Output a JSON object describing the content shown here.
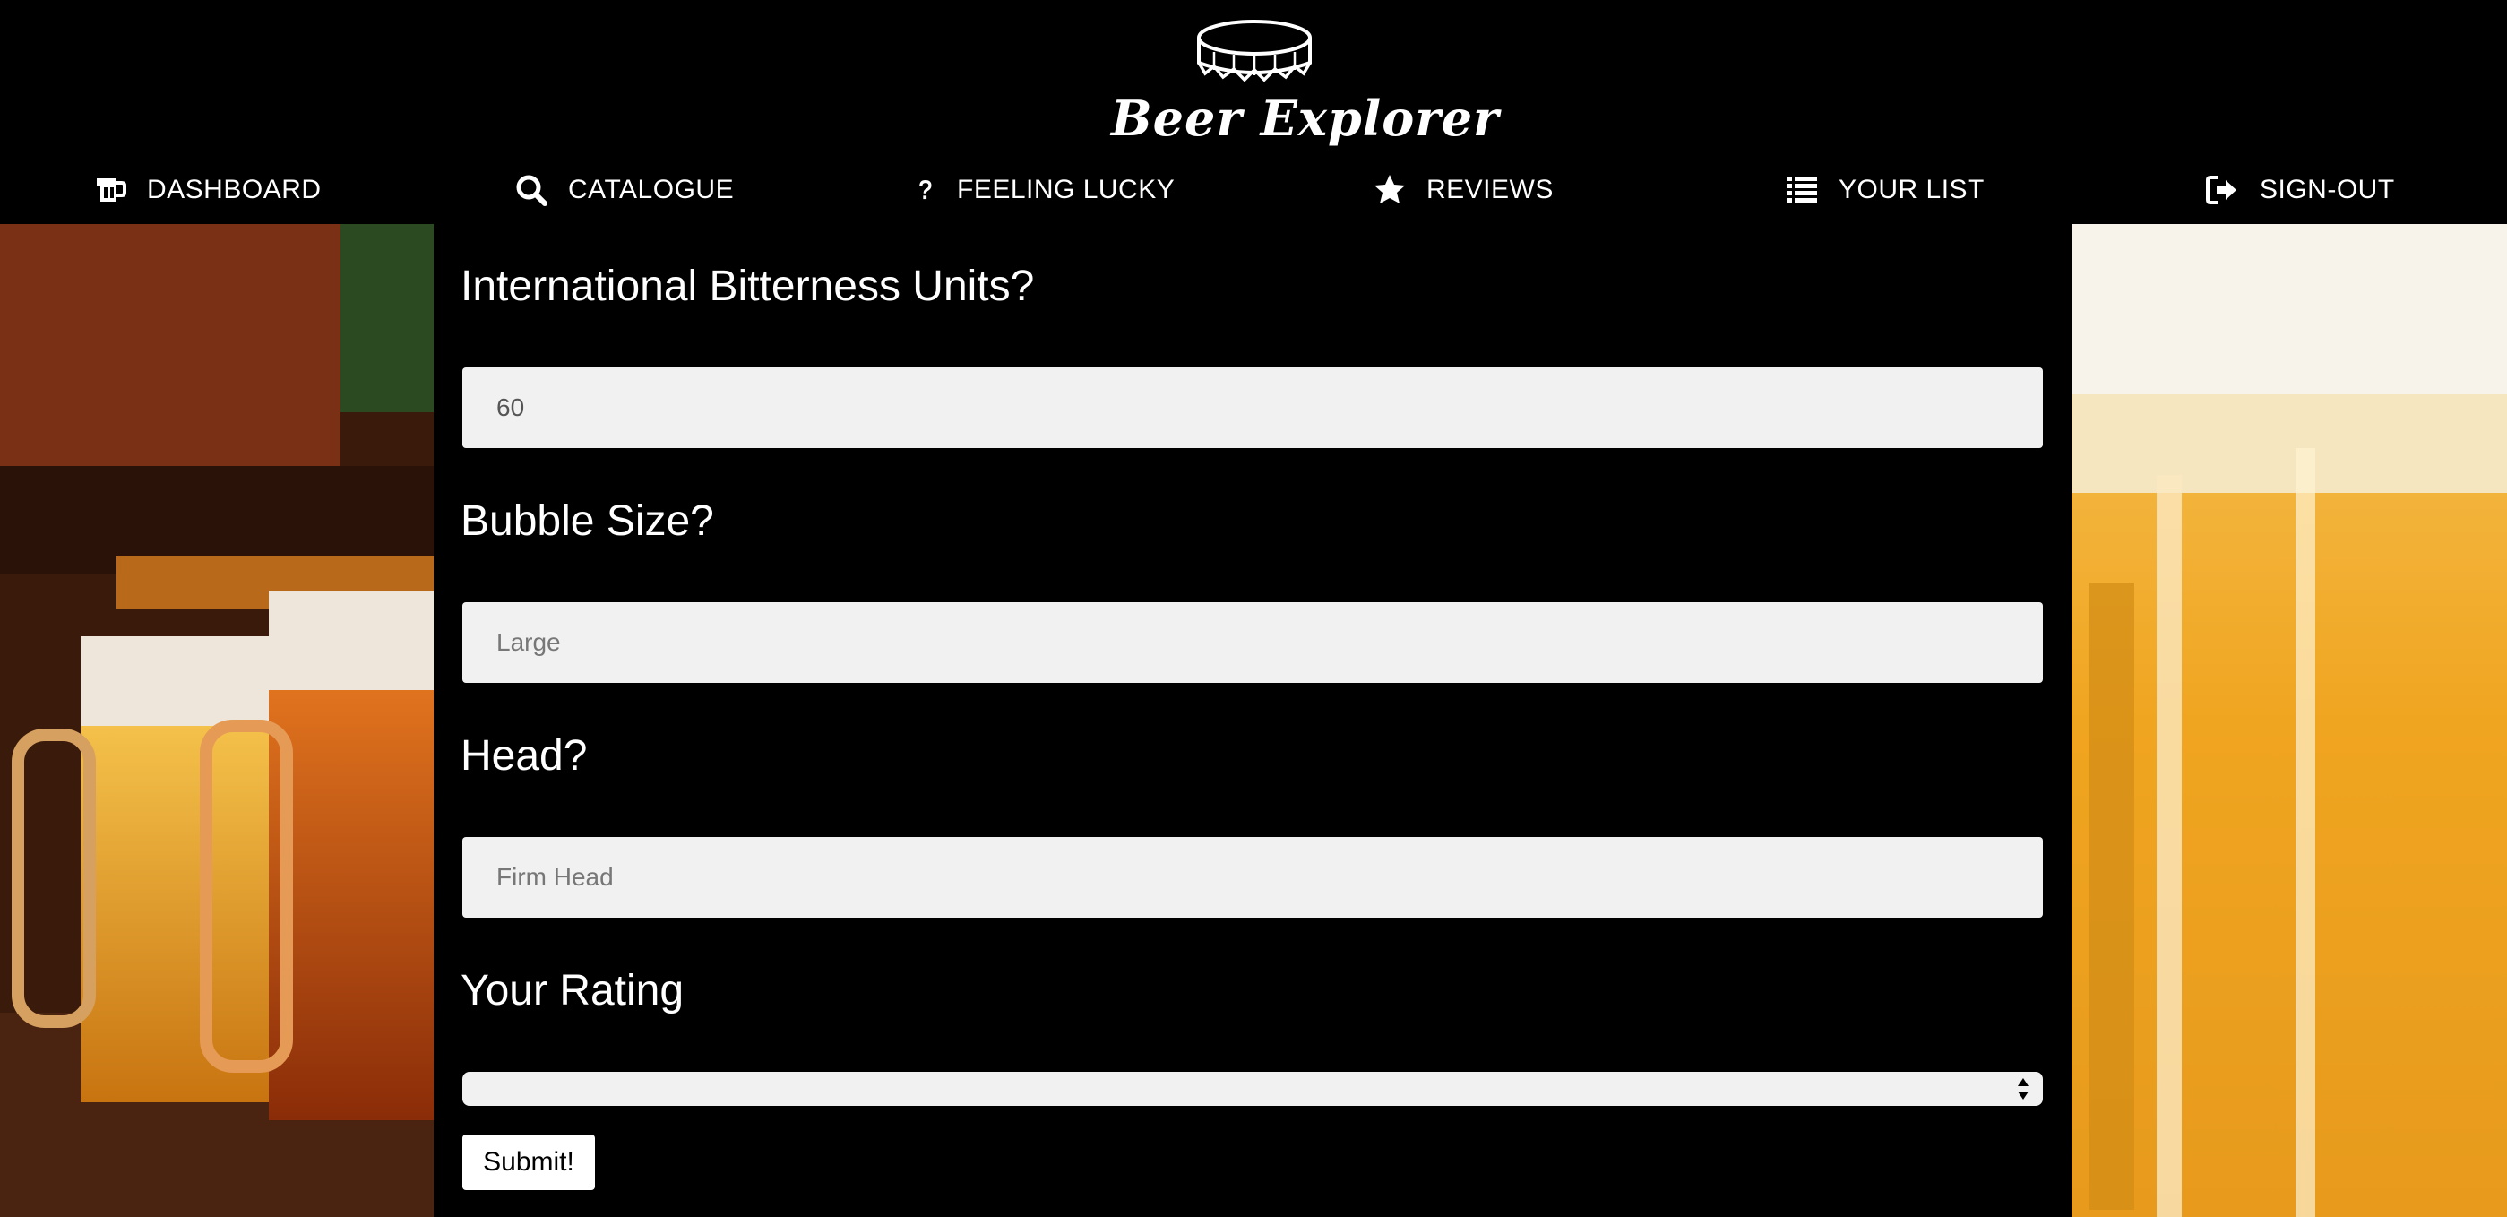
{
  "brand": {
    "name": "Beer Explorer"
  },
  "nav": {
    "items": [
      {
        "label": "DASHBOARD",
        "icon": "beer-mug-icon"
      },
      {
        "label": "CATALOGUE",
        "icon": "search-icon"
      },
      {
        "label": "FEELING LUCKY",
        "icon": "question-icon"
      },
      {
        "label": "REVIEWS",
        "icon": "star-icon"
      },
      {
        "label": "YOUR LIST",
        "icon": "list-icon"
      },
      {
        "label": "SIGN-OUT",
        "icon": "sign-out-icon"
      }
    ]
  },
  "form": {
    "ibu": {
      "label": "International Bitterness Units?",
      "value": "60"
    },
    "bubble_size": {
      "label": "Bubble Size?",
      "placeholder": "Large"
    },
    "head": {
      "label": "Head?",
      "placeholder": "Firm Head"
    },
    "rating": {
      "label": "Your Rating",
      "selected": ""
    },
    "submit_label": "Submit!"
  },
  "colors": {
    "background": "#000000",
    "text": "#ffffff",
    "input_bg": "#f1f1f1"
  }
}
